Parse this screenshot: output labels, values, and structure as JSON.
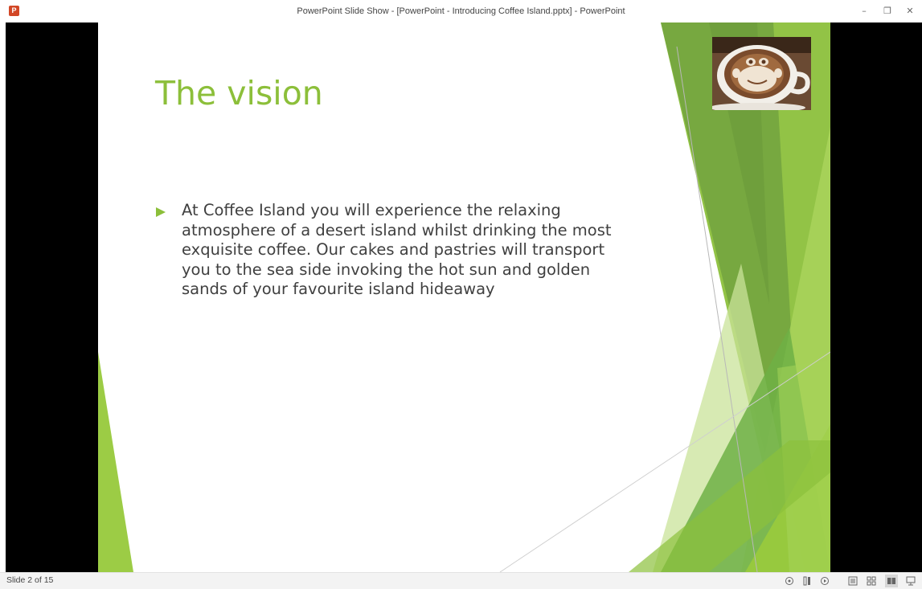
{
  "window": {
    "title": "PowerPoint Slide Show - [PowerPoint - Introducing Coffee Island.pptx] - PowerPoint",
    "app_icon_letter": "P",
    "minimize_glyph": "–",
    "restore_glyph": "❐",
    "close_glyph": "✕"
  },
  "slide": {
    "title": "The vision",
    "bullets": [
      "At Coffee Island you will experience the relaxing atmosphere of a desert island whilst drinking the most exquisite coffee. Our cakes and pastries will transport you to the sea side invoking the hot sun and golden sands of your favourite island hideaway"
    ],
    "accent_color": "#8cbf3a",
    "photo_icon": "coffee-latte-art-monkey"
  },
  "status_bar": {
    "slide_counter": "Slide 2 of 15",
    "icons": [
      "comment-icon",
      "notes-icon",
      "record-icon",
      "normal-view-icon",
      "slide-sorter-icon",
      "reading-view-icon",
      "slide-show-icon"
    ],
    "active_view": "reading-view-icon"
  }
}
